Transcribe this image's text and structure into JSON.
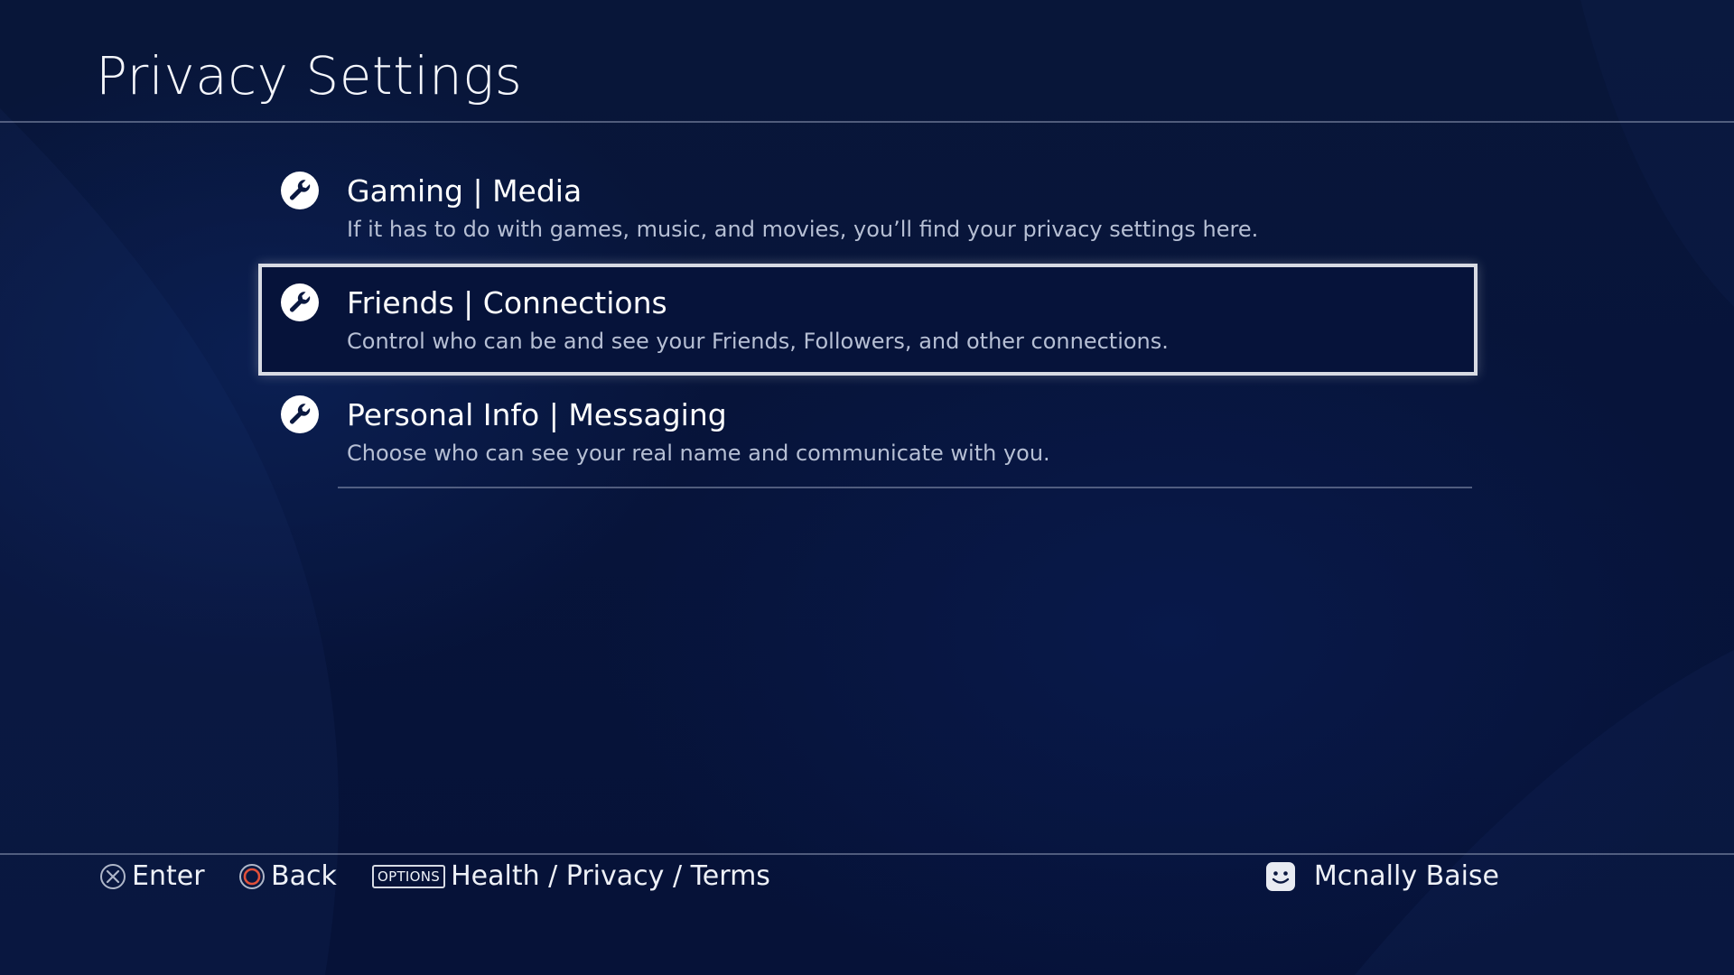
{
  "header": {
    "title": "Privacy Settings"
  },
  "menu": {
    "items": [
      {
        "label": "Gaming | Media",
        "description": "If it has to do with games, music, and movies, you’ll find your privacy settings here.",
        "icon": "wrench-icon",
        "focused": false
      },
      {
        "label": "Friends | Connections",
        "description": "Control who can be and see your Friends, Followers, and other connections.",
        "icon": "wrench-icon",
        "focused": true
      },
      {
        "label": "Personal Info | Messaging",
        "description": "Choose who can see your real name and communicate with you.",
        "icon": "wrench-icon",
        "focused": false
      }
    ]
  },
  "footer": {
    "enter_label": "Enter",
    "enter_icon": "cross-button-icon",
    "back_label": "Back",
    "back_icon": "circle-button-icon",
    "options_chip": "OPTIONS",
    "options_label": "Health / Privacy / Terms",
    "user_name": "Mcnally Baise",
    "user_icon": "avatar-icon"
  },
  "colors": {
    "background": "#071539",
    "focus_border": "#d8dbe3",
    "description_text": "#b6bfd4",
    "circle_button": "#e0503a"
  }
}
